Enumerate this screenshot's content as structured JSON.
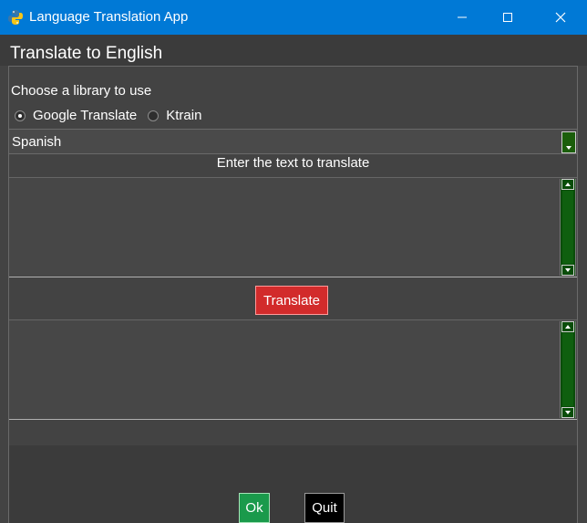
{
  "window": {
    "title": "Language Translation App",
    "title_bar_color": "#0079d6",
    "icon": "python-icon"
  },
  "main": {
    "frame_title": "Translate to English",
    "choose_label": "Choose a library to use",
    "libraries": [
      {
        "label": "Google Translate",
        "selected": true
      },
      {
        "label": "Ktrain",
        "selected": false
      }
    ],
    "language_select": {
      "value": "Spanish"
    },
    "input_label": "Enter the text to translate",
    "input_text": "",
    "output_text": "",
    "translate_button": "Translate",
    "ok_button": "Ok",
    "quit_button": "Quit"
  },
  "colors": {
    "translate_button": "#d22b2b",
    "ok_button": "#1a9a4b",
    "quit_button": "#000000",
    "scrollbar": "#0a4d0a"
  }
}
